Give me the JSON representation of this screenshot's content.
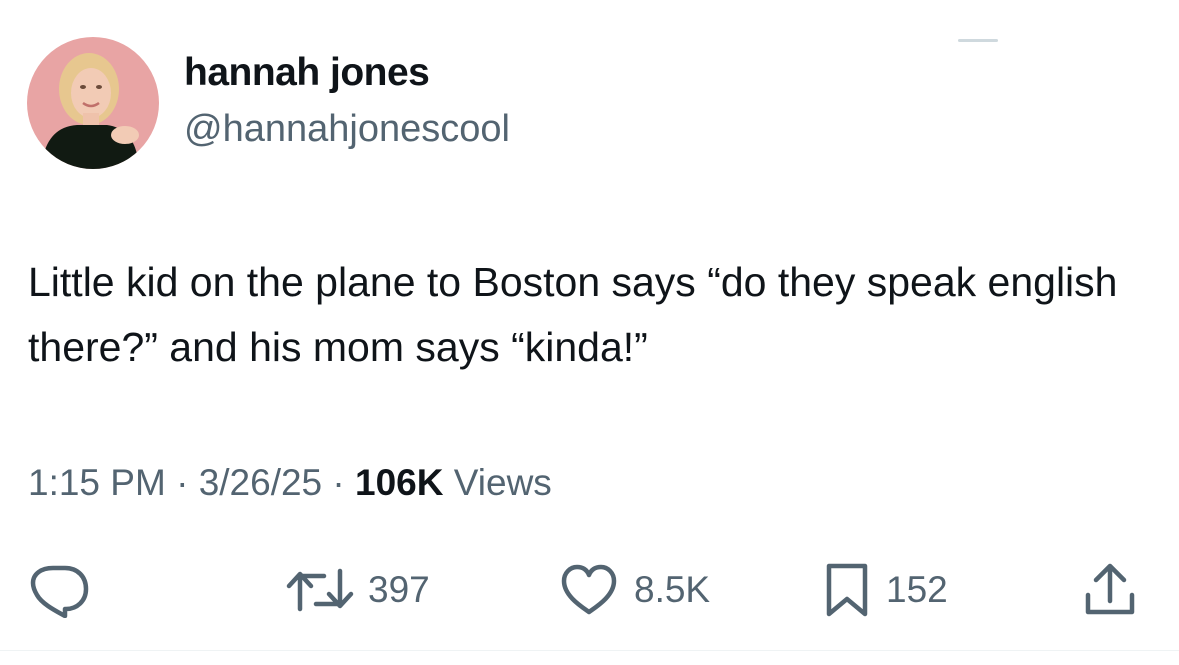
{
  "author": {
    "display_name": "hannah jones",
    "handle": "@hannahjonescool"
  },
  "tweet": {
    "text": "Little kid on the plane to Boston says “do they speak english there?” and his mom says “kinda!”",
    "time": "1:15 PM",
    "date": "3/26/25",
    "separator": "·",
    "views_count": "106K",
    "views_label": "Views"
  },
  "actions": {
    "reply": {
      "icon": "reply-icon"
    },
    "retweet": {
      "icon": "retweet-icon",
      "count": "397"
    },
    "like": {
      "icon": "heart-icon",
      "count": "8.5K"
    },
    "bookmark": {
      "icon": "bookmark-icon",
      "count": "152"
    },
    "share": {
      "icon": "share-icon"
    }
  },
  "colors": {
    "primary_text": "#0f1419",
    "secondary_text": "#536471",
    "background": "#ffffff",
    "avatar_background": "#e8a4a4"
  }
}
